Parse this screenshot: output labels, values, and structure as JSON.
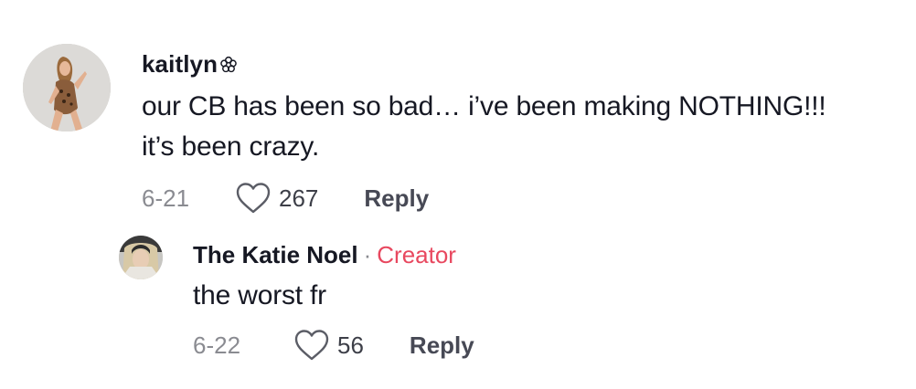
{
  "comments": [
    {
      "username": "kaitlyn",
      "username_icon": "flower-icon",
      "text_line1": "our CB has been so bad… i’ve been making NOTHING!!!",
      "text_line2": "it’s been crazy.",
      "date": "6-21",
      "likes": "267",
      "reply_label": "Reply",
      "replies": [
        {
          "username": "The Katie Noel",
          "separator": "·",
          "badge": "Creator",
          "text": "the worst fr",
          "date": "6-22",
          "likes": "56",
          "reply_label": "Reply"
        }
      ]
    }
  ],
  "colors": {
    "text": "#161823",
    "muted": "#8a8b91",
    "creator_badge": "#e8485f",
    "reply_button": "#474955"
  }
}
